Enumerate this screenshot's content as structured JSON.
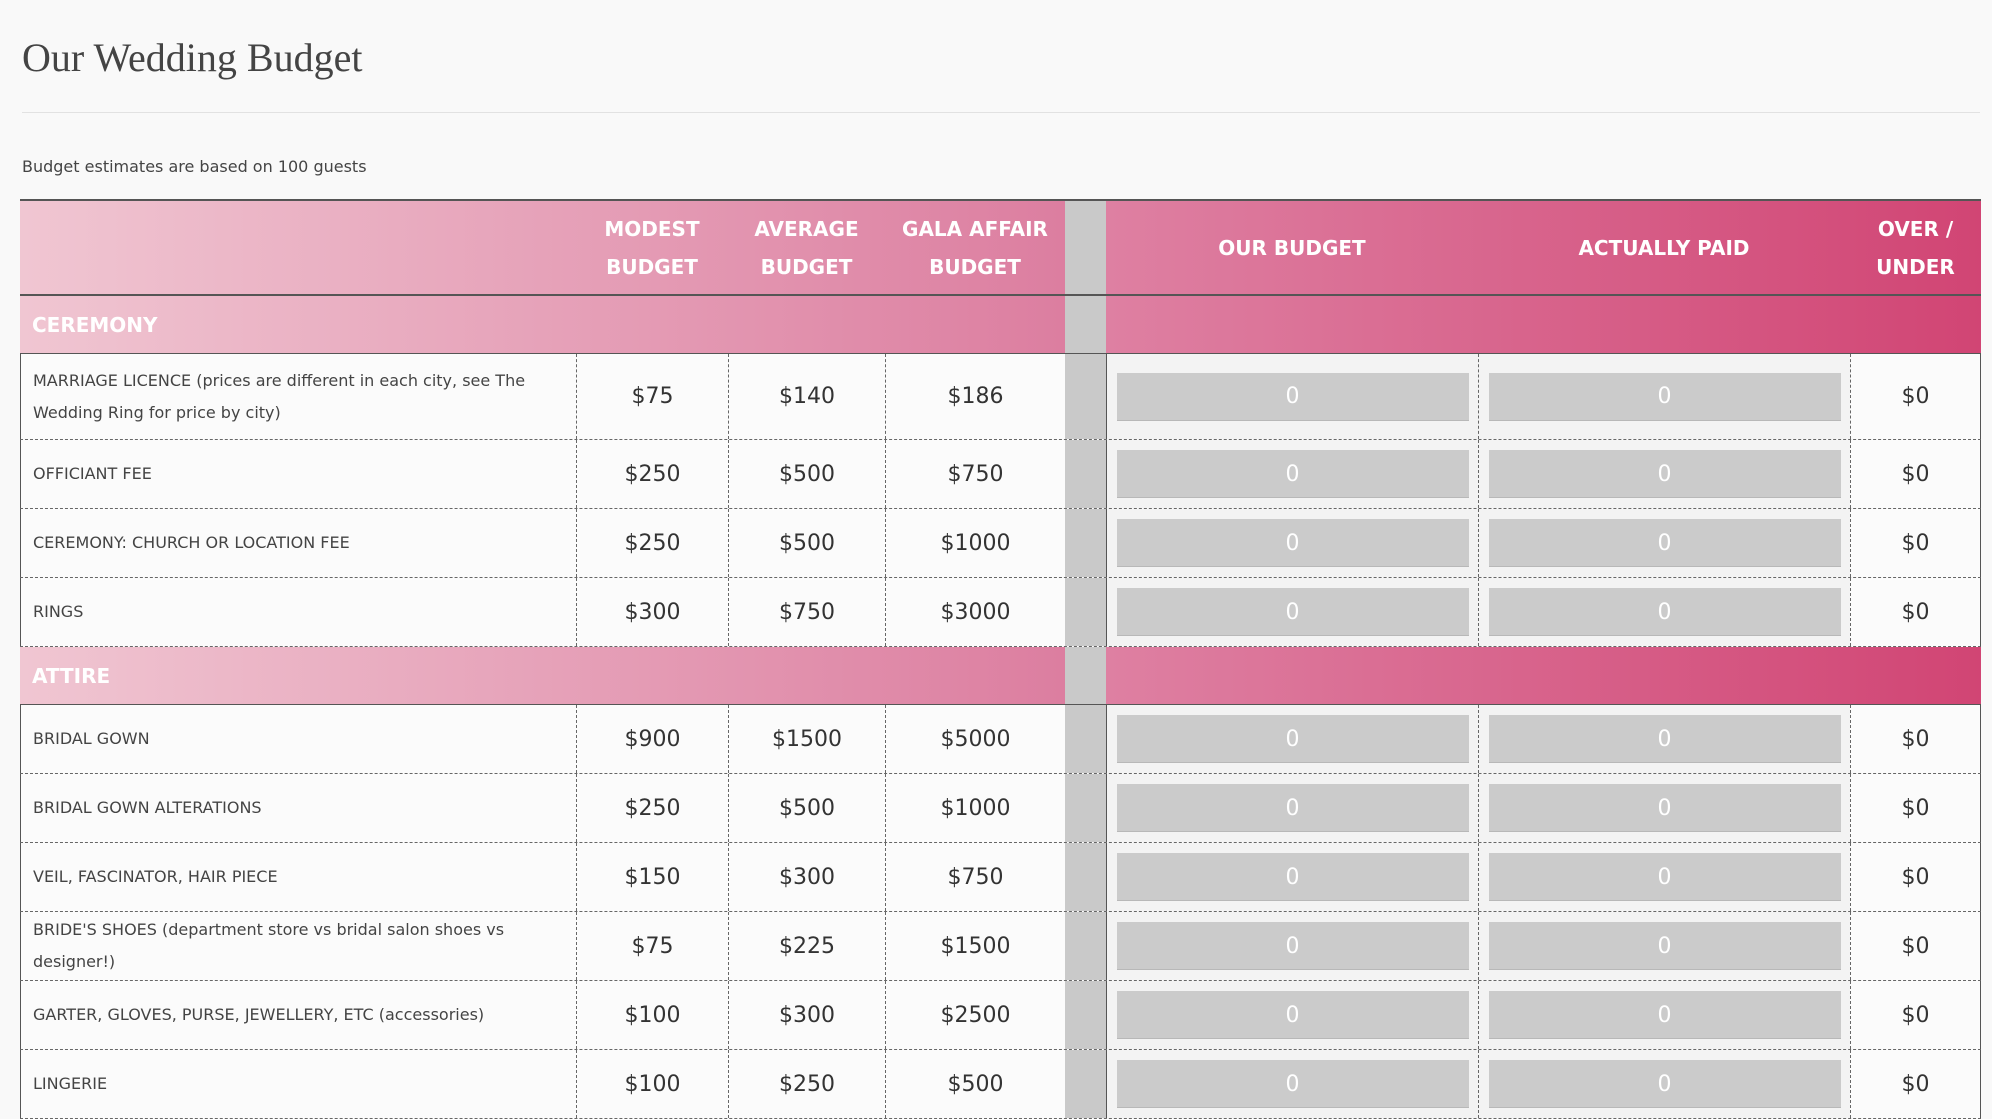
{
  "page": {
    "title": "Our Wedding Budget",
    "note": "Budget estimates are based on 100 guests"
  },
  "headers": {
    "modest": [
      "MODEST",
      "BUDGET"
    ],
    "average": [
      "AVERAGE",
      "BUDGET"
    ],
    "gala": [
      "GALA AFFAIR",
      "BUDGET"
    ],
    "our": "OUR BUDGET",
    "paid": "ACTUALLY PAID",
    "over": [
      "OVER /",
      "UNDER"
    ]
  },
  "colors": {
    "accent_light": "#f0c6d2",
    "accent_dark": "#d14574",
    "input_bg": "#cbcbcb"
  },
  "sections": [
    {
      "name": "CEREMONY",
      "rows": [
        {
          "item": "MARRIAGE LICENCE (prices are different in each city, see The Wedding Ring for price by city)",
          "modest": "$75",
          "average": "$140",
          "gala": "$186",
          "our": "0",
          "paid": "0",
          "over": "$0"
        },
        {
          "item": "OFFICIANT FEE",
          "modest": "$250",
          "average": "$500",
          "gala": "$750",
          "our": "0",
          "paid": "0",
          "over": "$0"
        },
        {
          "item": "CEREMONY: CHURCH OR LOCATION FEE",
          "modest": "$250",
          "average": "$500",
          "gala": "$1000",
          "our": "0",
          "paid": "0",
          "over": "$0"
        },
        {
          "item": "RINGS",
          "modest": "$300",
          "average": "$750",
          "gala": "$3000",
          "our": "0",
          "paid": "0",
          "over": "$0"
        }
      ]
    },
    {
      "name": "ATTIRE",
      "rows": [
        {
          "item": "BRIDAL GOWN",
          "modest": "$900",
          "average": "$1500",
          "gala": "$5000",
          "our": "0",
          "paid": "0",
          "over": "$0"
        },
        {
          "item": "BRIDAL GOWN ALTERATIONS",
          "modest": "$250",
          "average": "$500",
          "gala": "$1000",
          "our": "0",
          "paid": "0",
          "over": "$0"
        },
        {
          "item": "VEIL, FASCINATOR, HAIR PIECE",
          "modest": "$150",
          "average": "$300",
          "gala": "$750",
          "our": "0",
          "paid": "0",
          "over": "$0"
        },
        {
          "item": "BRIDE'S SHOES (department store vs bridal salon shoes vs designer!)",
          "modest": "$75",
          "average": "$225",
          "gala": "$1500",
          "our": "0",
          "paid": "0",
          "over": "$0"
        },
        {
          "item": "GARTER, GLOVES, PURSE, JEWELLERY, ETC (accessories)",
          "modest": "$100",
          "average": "$300",
          "gala": "$2500",
          "our": "0",
          "paid": "0",
          "over": "$0"
        },
        {
          "item": "LINGERIE",
          "modest": "$100",
          "average": "$250",
          "gala": "$500",
          "our": "0",
          "paid": "0",
          "over": "$0"
        }
      ]
    }
  ]
}
